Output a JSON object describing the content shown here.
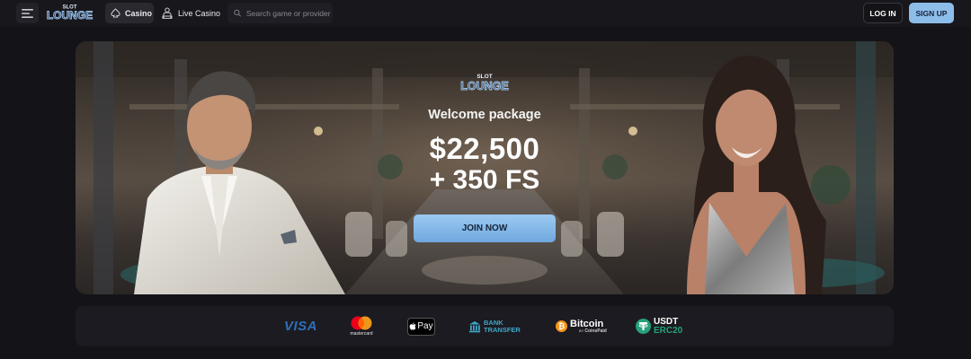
{
  "header": {
    "menu_icon": "hamburger-icon",
    "logo": {
      "top": "SLOT",
      "bottom": "LOUNGE"
    },
    "nav": [
      {
        "label": "Casino",
        "icon": "spade-icon",
        "active": true
      },
      {
        "label": "Live Casino",
        "icon": "dealer-icon",
        "active": false
      }
    ],
    "search": {
      "placeholder": "Search game or provider",
      "value": "",
      "icon": "search-icon"
    },
    "login_label": "LOG IN",
    "signup_label": "SIGN UP"
  },
  "hero": {
    "logo": {
      "top": "SLOT",
      "bottom": "LOUNGE"
    },
    "subtitle": "Welcome package",
    "amount": "$22,500",
    "free_spins": "+ 350 FS",
    "cta_label": "JOIN NOW"
  },
  "payments": {
    "visa": "VISA",
    "mastercard": "mastercard",
    "applepay": "Pay",
    "bank": {
      "line1": "BANK",
      "line2": "TRANSFER"
    },
    "bitcoin": {
      "name": "Bitcoin",
      "by": "BY",
      "provider": "CoinsPaid"
    },
    "usdt": {
      "line1": "USDT",
      "line2": "ERC20"
    }
  },
  "colors": {
    "background": "#141318",
    "accent": "#8dbde9",
    "bitcoin": "#f7931a",
    "usdt": "#26a17b",
    "bank": "#3fa7c9"
  }
}
